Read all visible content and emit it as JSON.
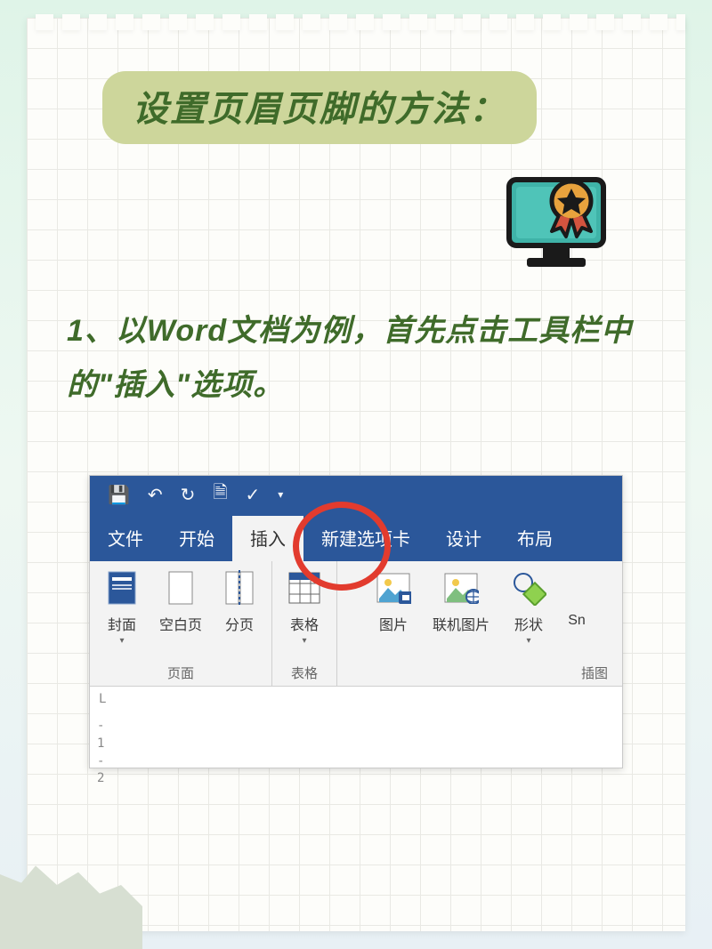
{
  "title": "设置页眉页脚的方法：",
  "step1": "1、以Word文档为例，首先点击工具栏中的\"插入\"选项。",
  "word": {
    "qat": {
      "save": "💾",
      "undo": "↶",
      "redo": "↻",
      "i1": "🗎",
      "i2": "✓"
    },
    "tabs": {
      "file": "文件",
      "home": "开始",
      "insert": "插入",
      "newtab": "新建选项卡",
      "design": "设计",
      "layout": "布局"
    },
    "ribbon": {
      "cover": "封面",
      "blank": "空白页",
      "pagebreak": "分页",
      "pages_group": "页面",
      "table": "表格",
      "table_group": "表格",
      "picture": "图片",
      "online_pic": "联机图片",
      "shapes": "形状",
      "sm": "Sn",
      "illus_group": "插图"
    },
    "ruler_l": "L",
    "ruler_v": "- | - | 2"
  }
}
